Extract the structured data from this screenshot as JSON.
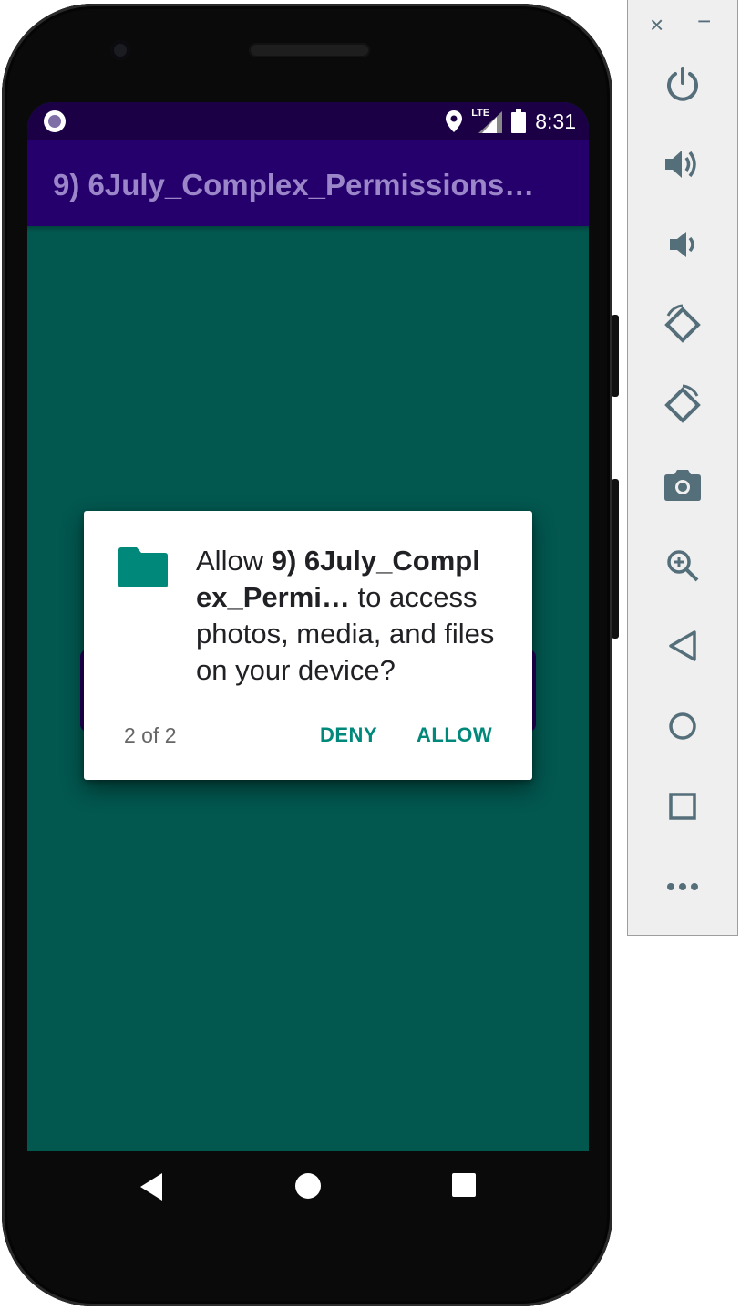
{
  "status_bar": {
    "time": "8:31",
    "network": "LTE"
  },
  "app_bar": {
    "title": "9) 6July_Complex_Permissions_..."
  },
  "dialog": {
    "prefix": "Allow ",
    "app_name": "9) 6July_Compl ex_Permi…",
    "suffix": " to access photos, media, and files on your device?",
    "counter": "2 of 2",
    "deny_label": "DENY",
    "allow_label": "ALLOW",
    "accent_color": "#00897b"
  },
  "colors": {
    "screen_bg": "#02574f",
    "app_bar_bg": "#25006c",
    "status_bar_bg": "#1b0046"
  },
  "toolbar": {
    "close_label": "×",
    "minimize_label": "−",
    "items": [
      "power-icon",
      "volume-up-icon",
      "volume-down-icon",
      "rotate-left-icon",
      "rotate-right-icon",
      "camera-icon",
      "zoom-icon",
      "back-icon",
      "home-icon",
      "overview-icon",
      "more-icon"
    ]
  }
}
